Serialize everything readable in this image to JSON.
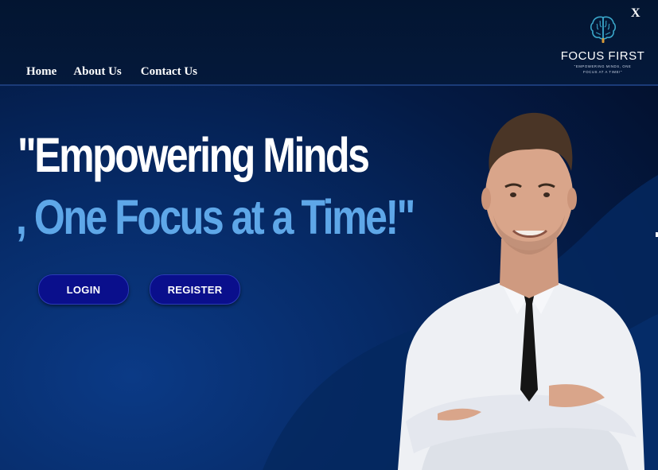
{
  "nav": {
    "home": "Home",
    "about": "About Us",
    "contact": "Contact Us"
  },
  "window": {
    "close": "X"
  },
  "logo": {
    "name": "FOCUS FIRST",
    "tagline_1": "\"EMPOWERING MINDS, ONE",
    "tagline_2": "FOCUS AT A TIME!\"",
    "icon": "brain-icon"
  },
  "hero": {
    "line1": "\"Empowering Minds",
    "line2": ", One Focus at a Time!\""
  },
  "buttons": {
    "login": "LOGIN",
    "register": "REGISTER"
  },
  "colors": {
    "accent": "#5ea7e8",
    "button": "#0a0f8c",
    "background": "#04193b"
  }
}
